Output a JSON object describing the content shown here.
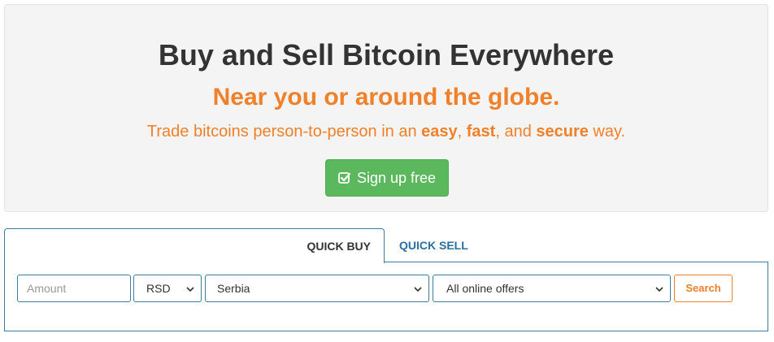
{
  "hero": {
    "title": "Buy and Sell Bitcoin Everywhere",
    "subtitle": "Near you or around the globe.",
    "tagline": {
      "prefix": "Trade bitcoins person-to-person in an ",
      "word1": "easy",
      "sep1": ", ",
      "word2": "fast",
      "sep2": ", and ",
      "word3": "secure",
      "suffix": " way."
    },
    "signup_button": {
      "label": "Sign up free",
      "icon": "check-square-icon",
      "color": "#5cb85c"
    },
    "accent_color": "#f0802a"
  },
  "quick_trade": {
    "tabs": [
      {
        "label": "QUICK BUY",
        "active": true
      },
      {
        "label": "QUICK SELL",
        "active": false
      }
    ],
    "amount": {
      "placeholder": "Amount",
      "value": ""
    },
    "currency": {
      "selected": "RSD"
    },
    "country": {
      "selected": "Serbia"
    },
    "payment_method": {
      "selected": "All online offers"
    },
    "search_button": {
      "label": "Search"
    },
    "border_color": "#3b7ea1"
  }
}
